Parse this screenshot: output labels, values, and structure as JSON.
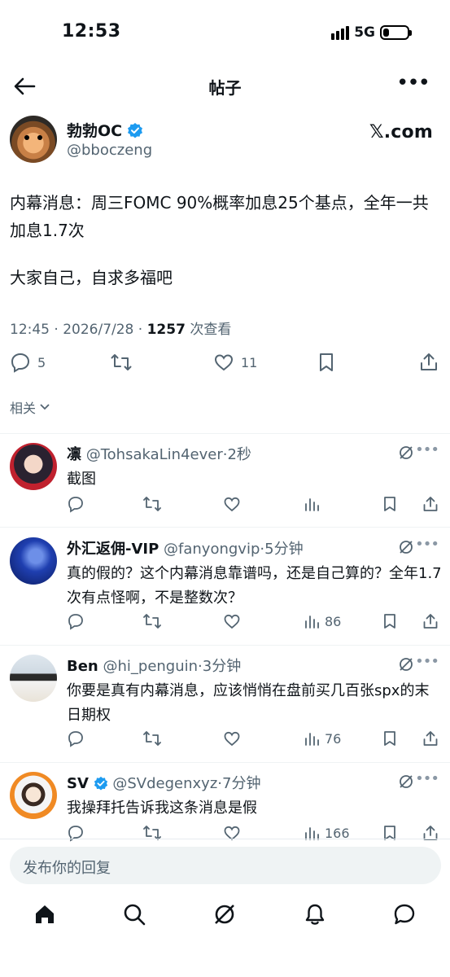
{
  "status_bar": {
    "time": "12:53",
    "network": "5G",
    "battery_level": 0.25
  },
  "header": {
    "title": "帖子"
  },
  "post": {
    "author_name": "勃勃OC",
    "author_handle": "@bboczeng",
    "source_logo": "𝕏.com",
    "text_line1": "内幕消息：周三FOMC 90%概率加息25个基点，全年一共加息1.7次",
    "text_line2": "大家自己，自求多福吧",
    "time": "12:45 · 2026/7/28 · ",
    "views_count": "1257",
    "views_label": " 次查看",
    "replies": "5",
    "likes": "11",
    "related_label": "相关"
  },
  "replies": [
    {
      "name": "凛",
      "handle": "@TohsakaLin4ever",
      "time": "·2秒",
      "verified": false,
      "text": "截图",
      "views": ""
    },
    {
      "name": "外汇返佣-VIP",
      "handle": "@fanyongvip",
      "time": "·5分钟",
      "verified": false,
      "text": "真的假的？这个内幕消息靠谱吗，还是自己算的？全年1.7次有点怪啊，不是整数次？",
      "views": "86"
    },
    {
      "name": "Ben",
      "handle": "@hi_penguin",
      "time": "·3分钟",
      "verified": false,
      "text": "你要是真有内幕消息，应该悄悄在盘前买几百张spx的末日期权",
      "views": "76"
    },
    {
      "name": "SV",
      "handle": "@SVdegenxyz",
      "time": "·7分钟",
      "verified": true,
      "text": "我操拜托告诉我这条消息是假",
      "views": "166"
    }
  ],
  "reply_input": {
    "placeholder": "发布你的回复"
  },
  "colors": {
    "accent": "#1d9bf0",
    "muted": "#536471",
    "text": "#0f1419"
  },
  "icons": {
    "nav": [
      "home-icon",
      "search-icon",
      "grok-icon",
      "bell-icon",
      "message-icon"
    ]
  }
}
